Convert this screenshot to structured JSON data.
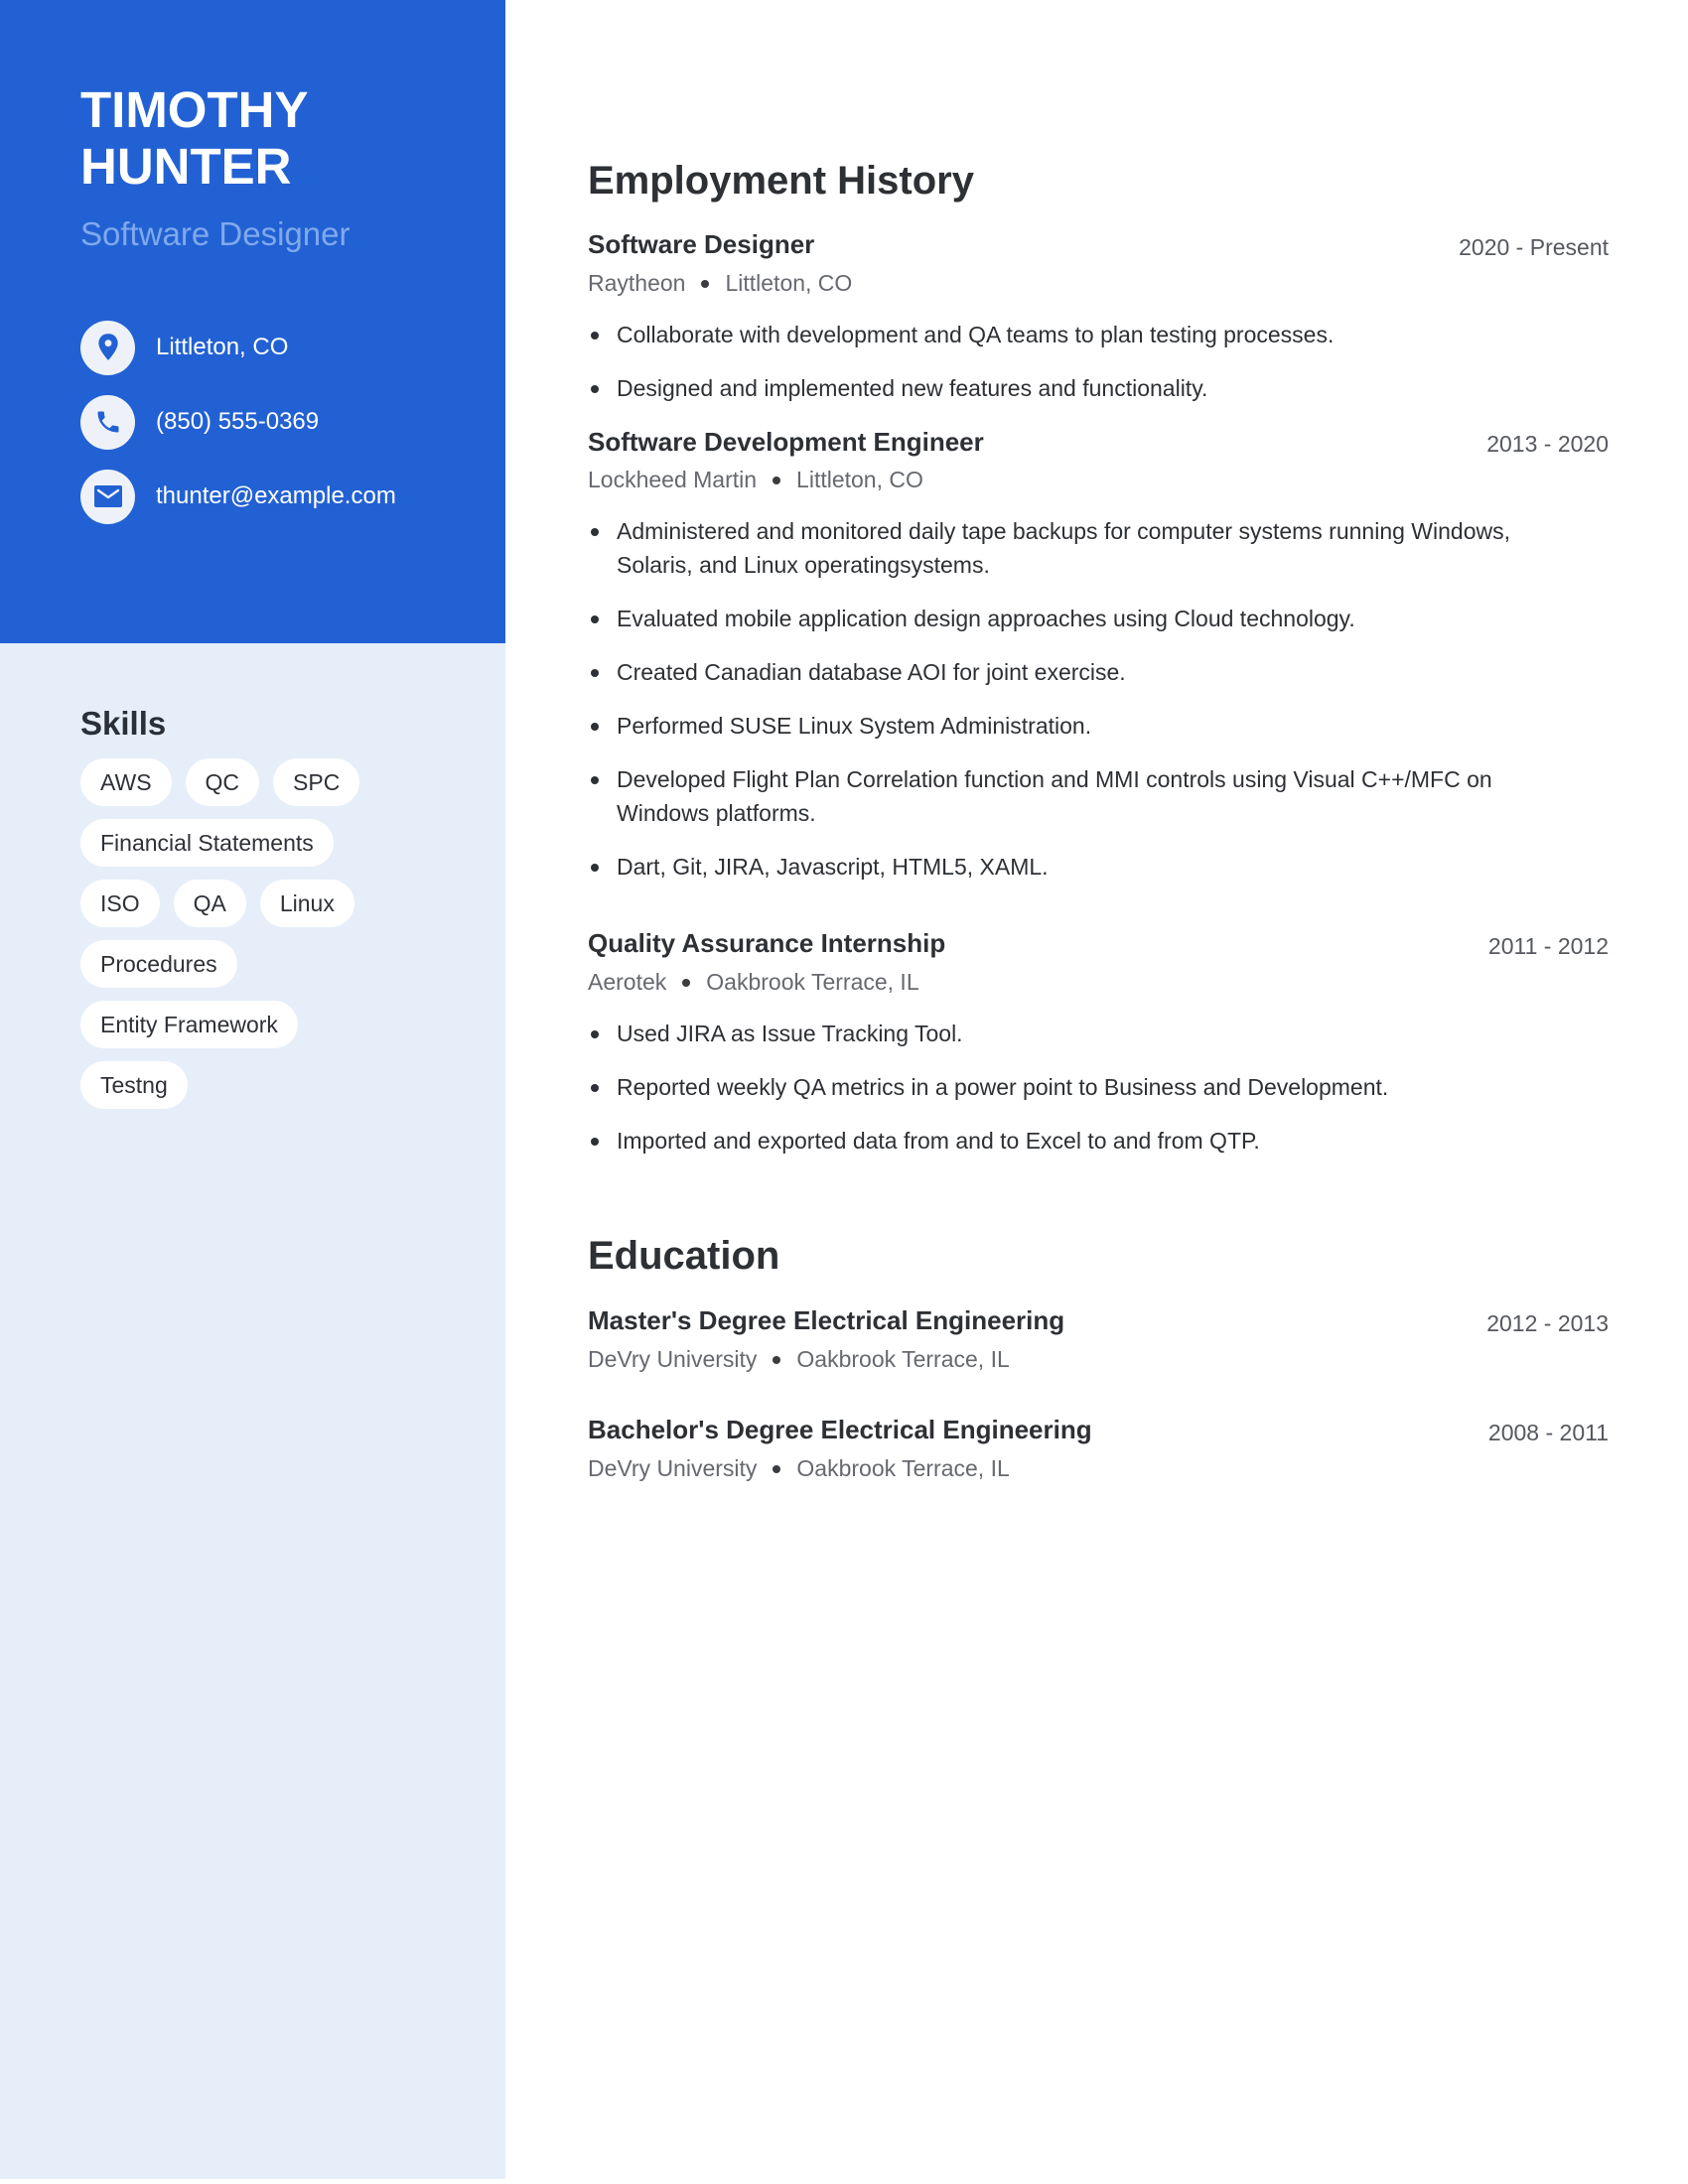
{
  "profile": {
    "first_name": "TIMOTHY",
    "last_name": "HUNTER",
    "title": "Software Designer"
  },
  "contact": [
    {
      "icon": "map-pin-icon",
      "text": "Littleton, CO"
    },
    {
      "icon": "phone-icon",
      "text": "(850) 555-0369"
    },
    {
      "icon": "envelope-icon",
      "text": "thunter@example.com"
    }
  ],
  "skills": {
    "heading": "Skills",
    "items": [
      "AWS",
      "QC",
      "SPC",
      "Financial Statements",
      "ISO",
      "QA",
      "Linux",
      "Procedures",
      "Entity Framework",
      "Testng"
    ]
  },
  "employment": {
    "heading": "Employment History",
    "jobs": [
      {
        "title": "Software Designer",
        "dates": "2020 - Present",
        "company": "Raytheon",
        "location": "Littleton, CO",
        "bullets": [
          "Collaborate with development and QA teams to plan testing processes.",
          "Designed and implemented new features and functionality."
        ]
      },
      {
        "title": "Software Development Engineer",
        "dates": "2013 - 2020",
        "company": "Lockheed Martin",
        "location": "Littleton, CO",
        "bullets": [
          "Administered and monitored daily tape backups for computer systems running Windows, Solaris, and Linux operatingsystems.",
          "Evaluated mobile application design approaches using Cloud technology.",
          "Created Canadian database AOI for joint exercise.",
          "Performed SUSE Linux System Administration.",
          "Developed Flight Plan Correlation function and MMI controls using Visual C++/MFC on Windows platforms.",
          "Dart, Git, JIRA, Javascript, HTML5, XAML."
        ]
      },
      {
        "title": "Quality Assurance Internship",
        "dates": "2011 - 2012",
        "company": "Aerotek",
        "location": "Oakbrook Terrace, IL",
        "bullets": [
          "Used JIRA as Issue Tracking Tool.",
          "Reported weekly QA metrics in a power point to Business and Development.",
          "Imported and exported data from and to Excel to and from QTP."
        ]
      }
    ]
  },
  "education": {
    "heading": "Education",
    "entries": [
      {
        "degree": "Master's Degree Electrical Engineering",
        "dates": "2012 - 2013",
        "school": "DeVry University",
        "location": "Oakbrook Terrace, IL"
      },
      {
        "degree": "Bachelor's Degree Electrical Engineering",
        "dates": "2008 - 2011",
        "school": "DeVry University",
        "location": "Oakbrook Terrace, IL"
      }
    ]
  },
  "colors": {
    "accent": "#2261d3",
    "sidebar_bg": "#e6eef9",
    "title_light": "#7fa9ec"
  }
}
